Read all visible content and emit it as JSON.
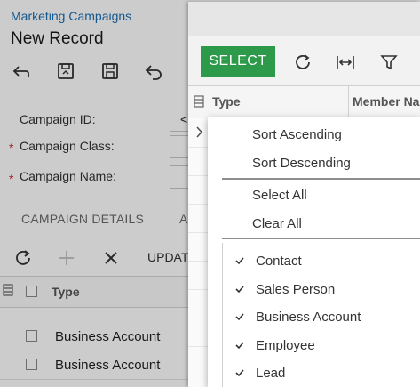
{
  "form": {
    "breadcrumb": "Marketing Campaigns",
    "title": "New Record",
    "toolbar": [
      "undo-icon",
      "save-close-icon",
      "save-icon",
      "cancel-icon"
    ],
    "fields": [
      {
        "label": "Campaign ID:",
        "required": false,
        "value": "<"
      },
      {
        "label": "Campaign Class:",
        "required": true,
        "value": ""
      },
      {
        "label": "Campaign Name:",
        "required": true,
        "value": ""
      }
    ],
    "required_mark": "*",
    "tabs": [
      "CAMPAIGN DETAILS",
      "A"
    ],
    "grid_toolbar": {
      "update_label": "UPDAT"
    },
    "grid": {
      "header_type": "Type",
      "rows": [
        "Business Account",
        "Business Account"
      ]
    }
  },
  "dialog": {
    "select_label": "SELECT",
    "columns": [
      "Type",
      "Member Na"
    ],
    "accent": "#2c9a4a"
  },
  "menu": {
    "sort": [
      "Sort Ascending",
      "Sort Descending"
    ],
    "selection": [
      "Select All",
      "Clear All"
    ],
    "filters": [
      {
        "label": "Contact",
        "checked": true
      },
      {
        "label": "Sales Person",
        "checked": true
      },
      {
        "label": "Business Account",
        "checked": true
      },
      {
        "label": "Employee",
        "checked": true
      },
      {
        "label": "Lead",
        "checked": true
      }
    ]
  }
}
